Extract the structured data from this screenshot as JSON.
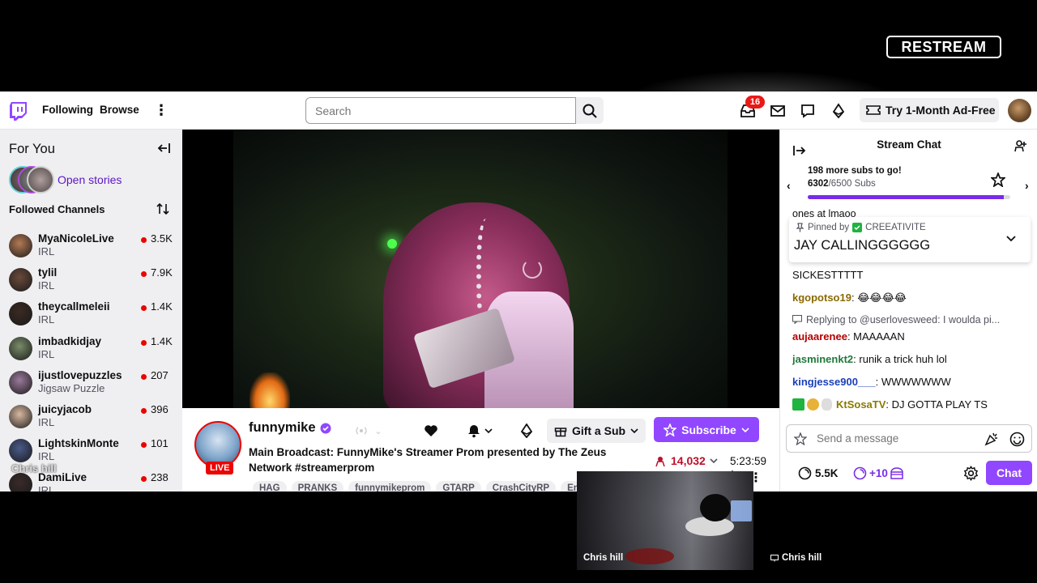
{
  "overlay": {
    "brand": "RESTREAM",
    "camera_name": "Chris hill",
    "camera_name_2": "Chris hill",
    "overlay_name_left": "Chris hill"
  },
  "nav": {
    "following": "Following",
    "browse": "Browse",
    "search_placeholder": "Search",
    "notification_count": "16",
    "ad_free": "Try 1-Month Ad-Free"
  },
  "sidebar": {
    "for_you": "For You",
    "open_stories": "Open stories",
    "followed_channels": "Followed Channels",
    "channels": [
      {
        "name": "MyaNicoleLive",
        "category": "IRL",
        "viewers": "3.5K",
        "color": "#b47a55"
      },
      {
        "name": "tylil",
        "category": "IRL",
        "viewers": "7.9K",
        "color": "#6a4a3a"
      },
      {
        "name": "theycallmeleii",
        "category": "IRL",
        "viewers": "1.4K",
        "color": "#3a2a22"
      },
      {
        "name": "imbadkidjay",
        "category": "IRL",
        "viewers": "1.4K",
        "color": "#7a8c6a"
      },
      {
        "name": "ijustlovepuzzles",
        "category": "Jigsaw Puzzle",
        "viewers": "207",
        "color": "#9a7a9a"
      },
      {
        "name": "juicyjacob",
        "category": "IRL",
        "viewers": "396",
        "color": "#d8b8a0"
      },
      {
        "name": "LightskinMonte",
        "category": "IRL",
        "viewers": "101",
        "color": "#4a5a8a"
      },
      {
        "name": "DamiLive",
        "category": "IRL",
        "viewers": "238",
        "color": "#3a2a2a"
      }
    ]
  },
  "stream": {
    "streamer": "funnymike",
    "live": "LIVE",
    "title": "Main Broadcast: FunnyMike's Streamer Prom presented by The Zeus Network #streamerprom",
    "gift_label": "Gift a Sub",
    "subscribe_label": "Subscribe",
    "viewers": "14,032",
    "uptime": "5:23:59",
    "tags": [
      "HAG",
      "PRANKS",
      "funnymikeprom",
      "GTARP",
      "CrashCityRP",
      "Englis"
    ]
  },
  "chat": {
    "title": "Stream Chat",
    "goal_main": "198 more subs to go!",
    "goal_current": "6302",
    "goal_target": "/6500 Subs",
    "goal_fraction": 0.9695,
    "cut_line": "ones at lmaoo",
    "pinned_by_label": "Pinned by",
    "pinned_by_user": "CREEATIVITE",
    "pinned_message": "JAY CALLINGGGGGG",
    "messages": [
      {
        "user": "",
        "text": "SICKESTTTTT",
        "color": "#0e0e10"
      },
      {
        "user": "kgopotso19",
        "text": ": 😂😂😂😂",
        "color": "#8a6a00"
      },
      {
        "user": "aujaarenee",
        "text": ": MAAAAAN",
        "color": "#b30000"
      },
      {
        "user": "jasminenkt2",
        "text": ": runik a trick huh lol",
        "color": "#1e7a3a"
      },
      {
        "user": "kingjesse900___",
        "text": ": WWWWWWW",
        "color": "#1a3fb8"
      },
      {
        "user": "KtSosaTV",
        "text": ": DJ GOTTA PLAY TS",
        "color": "#8a7a00"
      }
    ],
    "reply_context": "Replying to @userlovesweed: I woulda pi...",
    "input_placeholder": "Send a message",
    "points": "5.5K",
    "bonus": "+10",
    "chat_button": "Chat"
  }
}
